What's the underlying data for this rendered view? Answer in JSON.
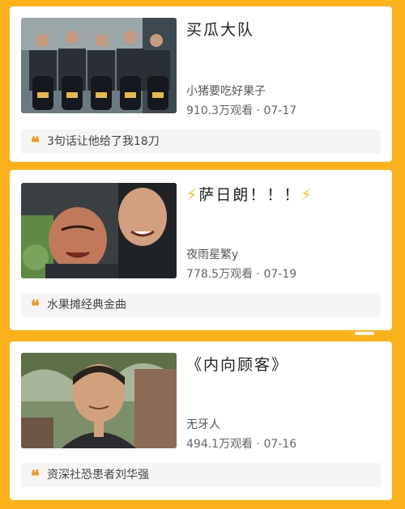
{
  "feed": [
    {
      "title": "买瓜大队",
      "author": "小猪要吃好果子",
      "views": "910.3万观看",
      "date": "07-17",
      "comment": "3句话让他给了我18刀",
      "thumbnail_icon": "video-thumbnail"
    },
    {
      "title": "萨日朗！！！",
      "title_icon": "lightning-bolt",
      "author": "夜雨星繁y",
      "views": "778.5万观看",
      "date": "07-19",
      "comment": "水果摊经典金曲",
      "thumbnail_icon": "video-thumbnail"
    },
    {
      "title": "《内向顾客》",
      "author": "无牙人",
      "views": "494.1万观看",
      "date": "07-16",
      "comment": "资深社恐患者刘华强",
      "thumbnail_icon": "video-thumbnail"
    }
  ],
  "separator": "·",
  "quote_glyph": "❝",
  "bolt_glyph": "⚡",
  "colors": {
    "background": "#fbb21b",
    "accent": "#f29b1b",
    "bolt": "#f8c51a"
  }
}
